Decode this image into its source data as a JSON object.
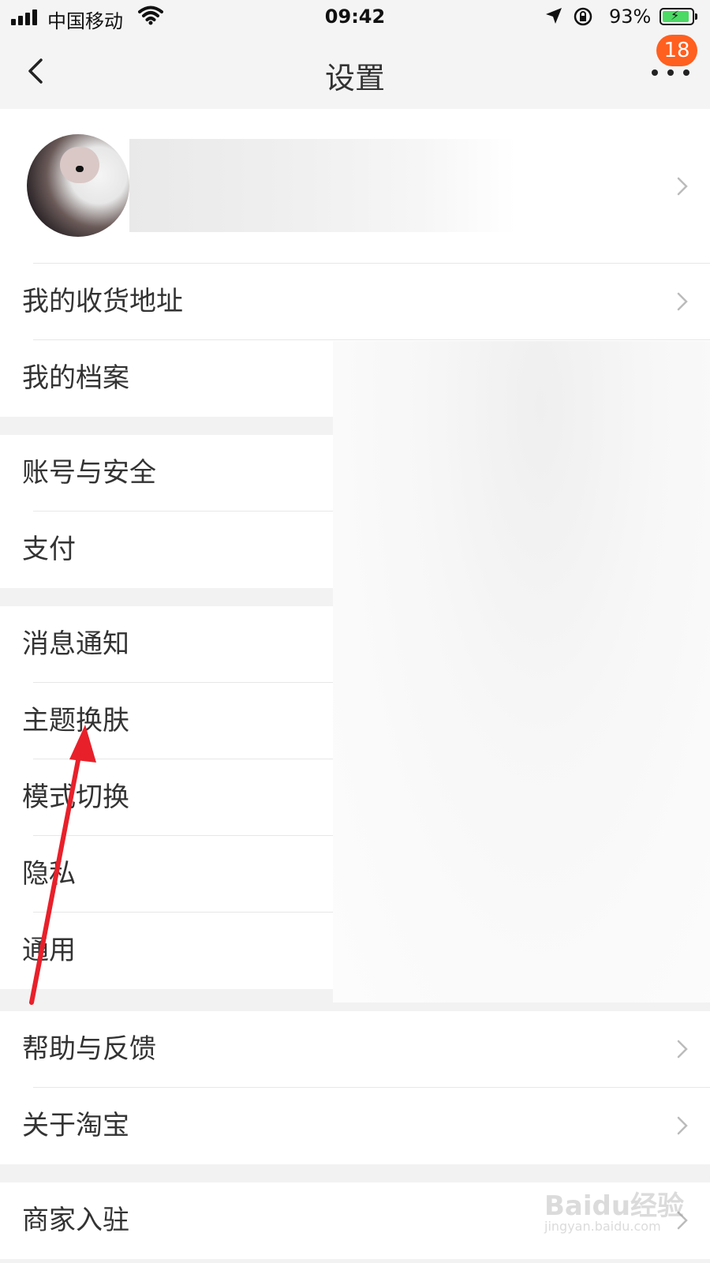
{
  "status_bar": {
    "carrier": "中国移动",
    "time": "09:42",
    "battery_percent": "93%",
    "battery_level": 0.93
  },
  "nav": {
    "title": "设置",
    "badge_count": "18"
  },
  "menu": {
    "group1": [
      {
        "label": "我的收货地址",
        "chevron": true
      },
      {
        "label": "我的档案",
        "chevron": false
      }
    ],
    "group2": [
      {
        "label": "账号与安全",
        "chevron": false
      },
      {
        "label": "支付",
        "chevron": false
      }
    ],
    "group3": [
      {
        "label": "消息通知",
        "chevron": false
      },
      {
        "label": "主题换肤",
        "chevron": false
      },
      {
        "label": "模式切换",
        "chevron": false
      },
      {
        "label": "隐私",
        "chevron": false
      },
      {
        "label": "通用",
        "chevron": false
      }
    ],
    "group4": [
      {
        "label": "帮助与反馈",
        "chevron": true
      },
      {
        "label": "关于淘宝",
        "chevron": true
      }
    ],
    "group5": [
      {
        "label": "商家入驻",
        "chevron": true
      }
    ]
  },
  "watermark": {
    "logo": "Baidu经验",
    "url": "jingyan.baidu.com"
  },
  "colors": {
    "badge": "#ff5f1f",
    "annotation_arrow": "#e8202a",
    "background": "#f2f2f2"
  }
}
